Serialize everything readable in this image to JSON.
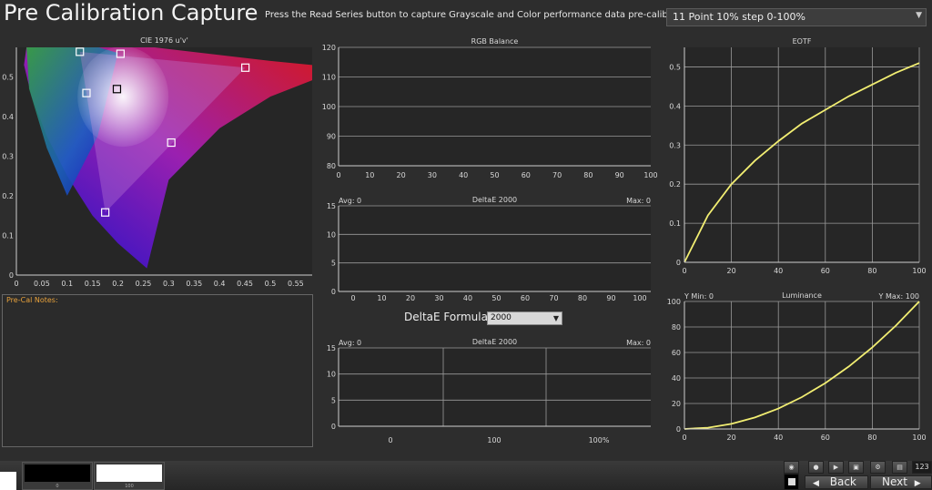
{
  "header": {
    "title": "Pre Calibration Capture",
    "instructions": "Press the Read Series button to capture Grayscale and Color performance data pre-calibration.",
    "series_selected": "11 Point 10% step 0-100%"
  },
  "colors": {
    "background": "#2d2d2d",
    "plot_bg": "#262626",
    "grid": "#9a9a9a",
    "curve": "#f2ee72",
    "notes_label": "#e8a23c"
  },
  "notes": {
    "label": "Pre-Cal Notes:"
  },
  "deltae_formula": {
    "label": "DeltaE Formula",
    "value": "2000"
  },
  "chart_data": [
    {
      "type": "scatter",
      "title": "CIE 1976 u'v'",
      "xlim": [
        0,
        0.6
      ],
      "ylim": [
        0,
        0.6
      ],
      "xticks": [
        "0",
        "0.05",
        "0.1",
        "0.15",
        "0.2",
        "0.25",
        "0.3",
        "0.35",
        "0.4",
        "0.45",
        "0.5",
        "0.55"
      ],
      "yticks": [
        "0",
        "0.1",
        "0.2",
        "0.3",
        "0.4",
        "0.5"
      ],
      "gamut_triangle": [
        [
          0.451,
          0.523
        ],
        [
          0.125,
          0.563
        ],
        [
          0.175,
          0.158
        ]
      ],
      "targets": [
        [
          0.451,
          0.523
        ],
        [
          0.125,
          0.563
        ],
        [
          0.175,
          0.158
        ],
        [
          0.205,
          0.558
        ],
        [
          0.305,
          0.334
        ],
        [
          0.138,
          0.459
        ],
        [
          0.198,
          0.469
        ]
      ]
    },
    {
      "type": "line",
      "title": "RGB Balance",
      "xlim": [
        0,
        100
      ],
      "ylim": [
        80,
        120
      ],
      "xticks": [
        "0",
        "10",
        "20",
        "30",
        "40",
        "50",
        "60",
        "70",
        "80",
        "90",
        "100"
      ],
      "yticks": [
        "80",
        "90",
        "100",
        "110",
        "120"
      ],
      "series": []
    },
    {
      "type": "bar",
      "title": "DeltaE 2000",
      "avg_label": "Avg: 0",
      "max_label": "Max: 0",
      "xlim": [
        0,
        100
      ],
      "ylim": [
        0,
        15
      ],
      "xticks": [
        "0",
        "10",
        "20",
        "30",
        "40",
        "50",
        "60",
        "70",
        "80",
        "90",
        "100"
      ],
      "yticks": [
        "0",
        "5",
        "10",
        "15"
      ],
      "values": []
    },
    {
      "type": "bar",
      "title": "DeltaE 2000",
      "avg_label": "Avg: 0",
      "max_label": "Max: 0",
      "ylim": [
        0,
        15
      ],
      "categories": [
        "0",
        "100",
        "100%"
      ],
      "yticks": [
        "0",
        "5",
        "10",
        "15"
      ],
      "values": []
    },
    {
      "type": "line",
      "title": "EOTF",
      "xlim": [
        0,
        100
      ],
      "ylim": [
        0,
        0.55
      ],
      "xticks": [
        "0",
        "20",
        "40",
        "60",
        "80",
        "100"
      ],
      "yticks": [
        "0",
        "0.1",
        "0.2",
        "0.3",
        "0.4",
        "0.5"
      ],
      "series": [
        {
          "x": [
            0,
            10,
            20,
            30,
            40,
            50,
            60,
            70,
            80,
            90,
            100
          ],
          "values": [
            0.0,
            0.12,
            0.2,
            0.26,
            0.31,
            0.355,
            0.39,
            0.425,
            0.455,
            0.485,
            0.51
          ]
        }
      ]
    },
    {
      "type": "line",
      "title": "Luminance",
      "ymin_label": "Y Min: 0",
      "ymax_label": "Y Max: 100",
      "xlim": [
        0,
        100
      ],
      "ylim": [
        0,
        100
      ],
      "xticks": [
        "0",
        "20",
        "40",
        "60",
        "80",
        "100"
      ],
      "yticks": [
        "0",
        "20",
        "40",
        "60",
        "80",
        "100"
      ],
      "series": [
        {
          "x": [
            0,
            10,
            20,
            30,
            40,
            50,
            60,
            70,
            80,
            90,
            100
          ],
          "values": [
            0,
            1,
            4,
            9,
            16,
            25,
            36,
            49,
            64,
            81,
            100
          ]
        }
      ]
    }
  ],
  "bottom": {
    "swatch_black_label": "0",
    "swatch_white_label": "100",
    "counter": "123",
    "back_label": "Back",
    "next_label": "Next"
  }
}
